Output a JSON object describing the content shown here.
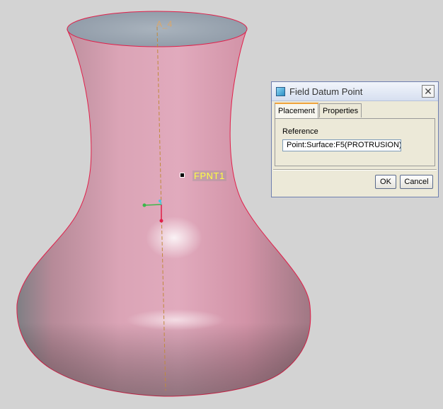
{
  "viewport": {
    "axis_label": "A_4",
    "point_label": "FPNT1",
    "colors": {
      "background": "#d3d3d3",
      "surface": "#d896aa",
      "edge": "#e0204a",
      "axis": "#c08a3c",
      "point_label": "#ffff40"
    }
  },
  "dialog": {
    "title": "Field Datum Point",
    "close_symbol": "✕",
    "tabs": [
      {
        "label": "Placement",
        "active": true
      },
      {
        "label": "Properties",
        "active": false
      }
    ],
    "reference_caption": "Reference",
    "reference_value": "Point:Surface:F5(PROTRUSION)",
    "ok_label": "OK",
    "cancel_label": "Cancel"
  }
}
